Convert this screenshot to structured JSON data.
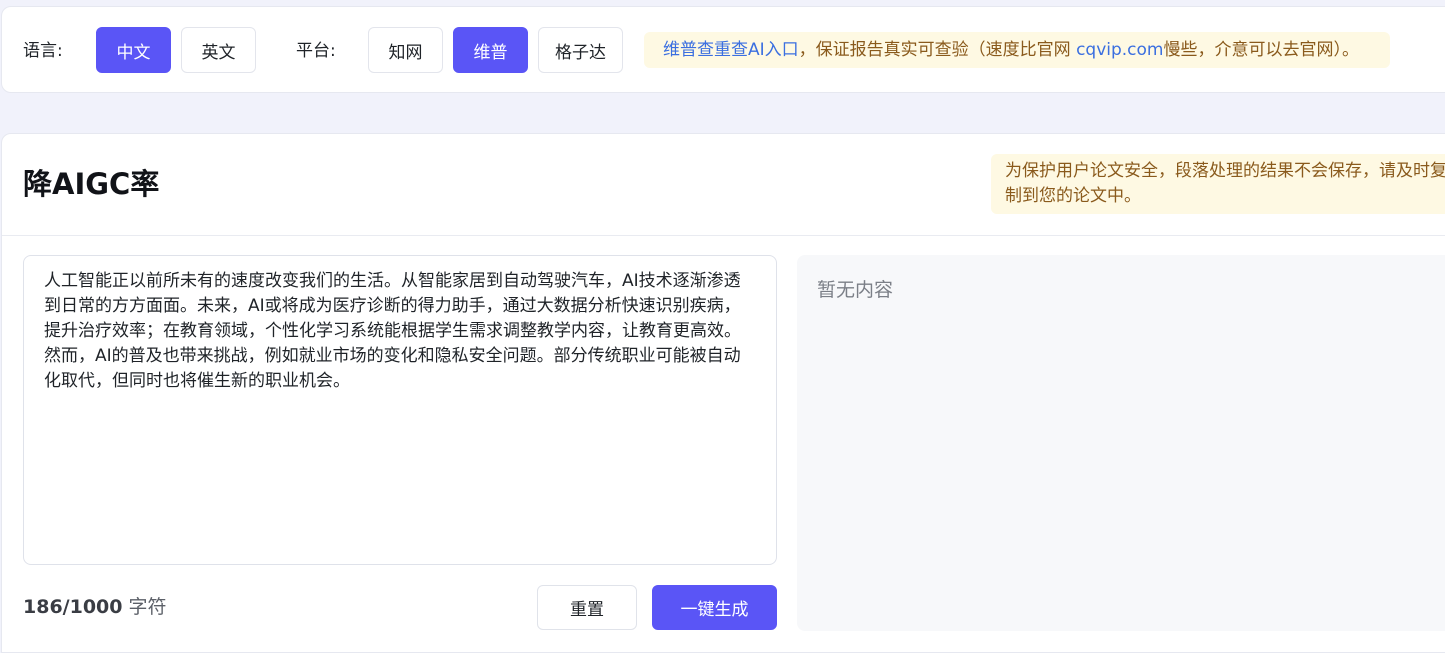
{
  "topbar": {
    "language_label": "语言:",
    "languages": [
      {
        "label": "中文",
        "active": true
      },
      {
        "label": "英文",
        "active": false
      }
    ],
    "platform_label": "平台:",
    "platforms": [
      {
        "label": "知网",
        "active": false
      },
      {
        "label": "维普",
        "active": true
      },
      {
        "label": "格子达",
        "active": false
      }
    ],
    "notice": {
      "link_text": "维普查重查AI入口",
      "text_part1": "，保证报告真实可查验（速度比官网 ",
      "site_link": "cqvip.com",
      "text_part2": "慢些，介意可以去官网）。"
    }
  },
  "main": {
    "title": "降AIGC率",
    "tip": "为保护用户论文安全，段落处理的结果不会保存，请及时复制到您的论文中。",
    "input_text": "人工智能正以前所未有的速度改变我们的生活。从智能家居到自动驾驶汽车，AI技术逐渐渗透到日常的方方面面。未来，AI或将成为医疗诊断的得力助手，通过大数据分析快速识别疾病，提升治疗效率；在教育领域，个性化学习系统能根据学生需求调整教学内容，让教育更高效。然而，AI的普及也带来挑战，例如就业市场的变化和隐私安全问题。部分传统职业可能被自动化取代，但同时也将催生新的职业机会。",
    "char_count": "186/1000",
    "char_unit": "字符",
    "reset_label": "重置",
    "generate_label": "一键生成",
    "output_placeholder": "暂无内容"
  },
  "colors": {
    "accent": "#5a55f6",
    "notice_bg": "#fef9e3",
    "notice_text": "#8a5a1c",
    "link": "#3b6fe0"
  }
}
